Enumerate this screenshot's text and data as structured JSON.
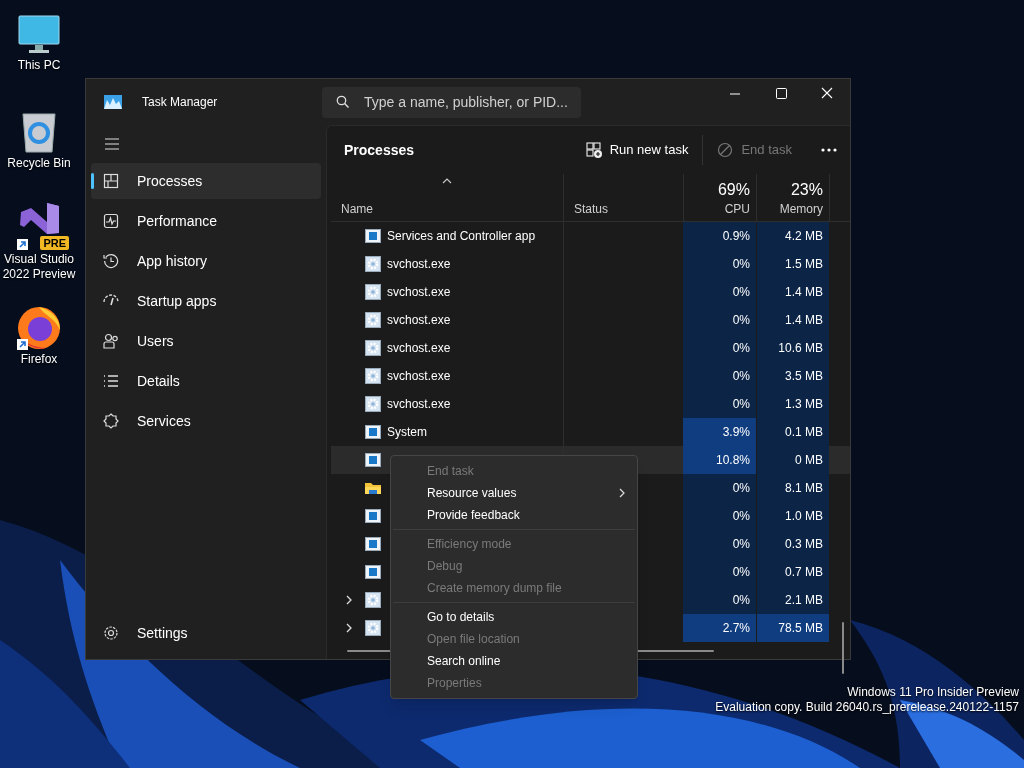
{
  "desktop_icons": [
    {
      "label": "This PC",
      "kind": "monitor",
      "shortcut": false
    },
    {
      "label": "Recycle Bin",
      "kind": "bin",
      "shortcut": false
    },
    {
      "label": "Visual Studio 2022 Preview",
      "kind": "ide",
      "badge": "PRE",
      "shortcut": true
    },
    {
      "label": "Firefox",
      "kind": "browser",
      "shortcut": true
    }
  ],
  "window": {
    "title": "Task Manager",
    "search": {
      "placeholder": "Type a name, publisher, or PID..."
    }
  },
  "sidebar": {
    "items": [
      {
        "label": "Processes",
        "kind": "processes",
        "selected": true
      },
      {
        "label": "Performance",
        "kind": "performance",
        "selected": false
      },
      {
        "label": "App history",
        "kind": "history",
        "selected": false
      },
      {
        "label": "Startup apps",
        "kind": "startup",
        "selected": false
      },
      {
        "label": "Users",
        "kind": "users",
        "selected": false
      },
      {
        "label": "Details",
        "kind": "details",
        "selected": false
      },
      {
        "label": "Services",
        "kind": "services",
        "selected": false
      }
    ],
    "settings": "Settings"
  },
  "toolbar": {
    "title": "Processes",
    "actions": [
      {
        "label": "Run new task",
        "kind": "run",
        "disabled": false
      },
      {
        "label": "End task",
        "kind": "end",
        "disabled": true
      }
    ]
  },
  "table": {
    "columns": [
      {
        "label": "Name",
        "sorted": true
      },
      {
        "label": "Status",
        "sorted": false
      },
      {
        "label": "CPU",
        "total": "69%",
        "sorted": false
      },
      {
        "label": "Memory",
        "total": "23%",
        "sorted": false
      }
    ],
    "rows": [
      {
        "name": "Services and Controller app",
        "kind": "app",
        "expandable": false,
        "selected": false,
        "cpu": "0.9%",
        "cpu_high": false,
        "memory": "4.2 MB",
        "memory_high": false
      },
      {
        "name": "svchost.exe",
        "kind": "gear",
        "expandable": false,
        "selected": false,
        "cpu": "0%",
        "cpu_high": false,
        "memory": "1.5 MB",
        "memory_high": false
      },
      {
        "name": "svchost.exe",
        "kind": "gear",
        "expandable": false,
        "selected": false,
        "cpu": "0%",
        "cpu_high": false,
        "memory": "1.4 MB",
        "memory_high": false
      },
      {
        "name": "svchost.exe",
        "kind": "gear",
        "expandable": false,
        "selected": false,
        "cpu": "0%",
        "cpu_high": false,
        "memory": "1.4 MB",
        "memory_high": false
      },
      {
        "name": "svchost.exe",
        "kind": "gear",
        "expandable": false,
        "selected": false,
        "cpu": "0%",
        "cpu_high": false,
        "memory": "10.6 MB",
        "memory_high": false
      },
      {
        "name": "svchost.exe",
        "kind": "gear",
        "expandable": false,
        "selected": false,
        "cpu": "0%",
        "cpu_high": false,
        "memory": "3.5 MB",
        "memory_high": false
      },
      {
        "name": "svchost.exe",
        "kind": "gear",
        "expandable": false,
        "selected": false,
        "cpu": "0%",
        "cpu_high": false,
        "memory": "1.3 MB",
        "memory_high": false
      },
      {
        "name": "System",
        "kind": "app",
        "expandable": false,
        "selected": false,
        "cpu": "3.9%",
        "cpu_high": true,
        "memory": "0.1 MB",
        "memory_high": false
      },
      {
        "kind": "app",
        "expandable": false,
        "selected": true,
        "cpu": "10.8%",
        "cpu_high": true,
        "memory": "0 MB",
        "memory_high": false
      },
      {
        "kind": "folder",
        "expandable": false,
        "selected": false,
        "cpu": "0%",
        "cpu_high": false,
        "memory": "8.1 MB",
        "memory_high": false
      },
      {
        "kind": "app",
        "expandable": false,
        "selected": false,
        "cpu": "0%",
        "cpu_high": false,
        "memory": "1.0 MB",
        "memory_high": false
      },
      {
        "kind": "app",
        "expandable": false,
        "selected": false,
        "cpu": "0%",
        "cpu_high": false,
        "memory": "0.3 MB",
        "memory_high": false
      },
      {
        "kind": "app",
        "expandable": false,
        "selected": false,
        "cpu": "0%",
        "cpu_high": false,
        "memory": "0.7 MB",
        "memory_high": false
      },
      {
        "kind": "gear",
        "expandable": true,
        "selected": false,
        "cpu": "0%",
        "cpu_high": false,
        "memory": "2.1 MB",
        "memory_high": false
      },
      {
        "kind": "gear",
        "expandable": true,
        "selected": false,
        "cpu": "2.7%",
        "cpu_high": true,
        "memory": "78.5 MB",
        "memory_high": true
      }
    ]
  },
  "context_menu": {
    "items": [
      {
        "kind": "item",
        "label": "End task",
        "disabled": true,
        "submenu": false
      },
      {
        "kind": "item",
        "label": "Resource values",
        "disabled": false,
        "submenu": true
      },
      {
        "kind": "item",
        "label": "Provide feedback",
        "disabled": false,
        "submenu": false
      },
      {
        "kind": "separator"
      },
      {
        "kind": "item",
        "label": "Efficiency mode",
        "disabled": true,
        "submenu": false
      },
      {
        "kind": "item",
        "label": "Debug",
        "disabled": true,
        "submenu": false
      },
      {
        "kind": "item",
        "label": "Create memory dump file",
        "disabled": true,
        "submenu": false
      },
      {
        "kind": "separator"
      },
      {
        "kind": "item",
        "label": "Go to details",
        "disabled": false,
        "submenu": false
      },
      {
        "kind": "item",
        "label": "Open file location",
        "disabled": true,
        "submenu": false
      },
      {
        "kind": "item",
        "label": "Search online",
        "disabled": false,
        "submenu": false
      },
      {
        "kind": "item",
        "label": "Properties",
        "disabled": true,
        "submenu": false
      }
    ]
  },
  "os_notice": [
    "Windows 11 Pro Insider Preview",
    "Evaluation copy. Build 26040.rs_prerelease.240122-1157"
  ]
}
